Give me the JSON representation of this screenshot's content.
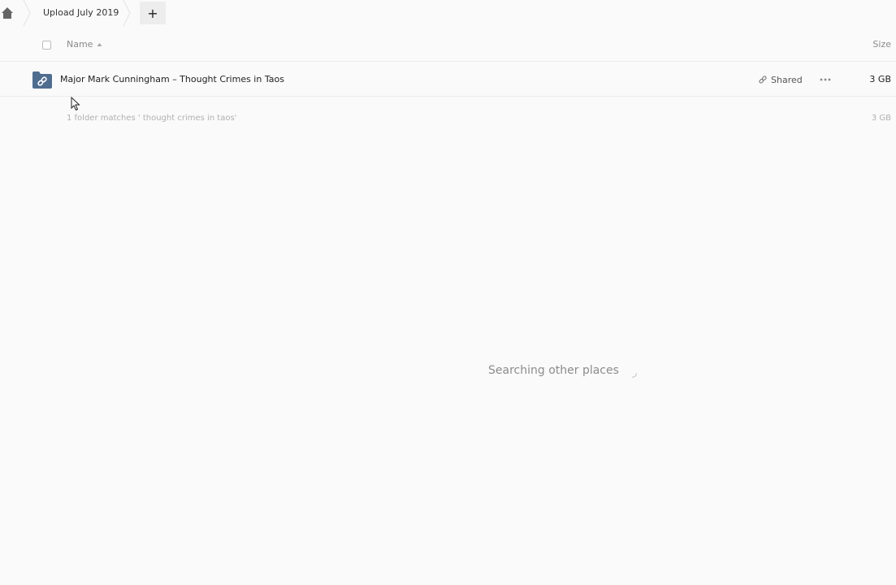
{
  "breadcrumb": {
    "home_icon": "home-icon",
    "current_folder": "Upload July 2019",
    "add_label": "+"
  },
  "table": {
    "columns": {
      "name": "Name",
      "size": "Size"
    },
    "sort": {
      "column": "Name",
      "direction": "ascending"
    },
    "rows": [
      {
        "icon": "shared-folder-icon",
        "name": "Major Mark Cunningham – Thought Crimes in Taos",
        "share_label": "Shared",
        "size": "3 GB"
      }
    ],
    "summary": {
      "text": "1 folder matches ' thought crimes in taos'",
      "size": "3 GB"
    }
  },
  "search_status": "Searching other places",
  "colors": {
    "background": "#fafafa",
    "folder_icon": "#4f6d8f",
    "muted_text": "#8c8c8c"
  }
}
